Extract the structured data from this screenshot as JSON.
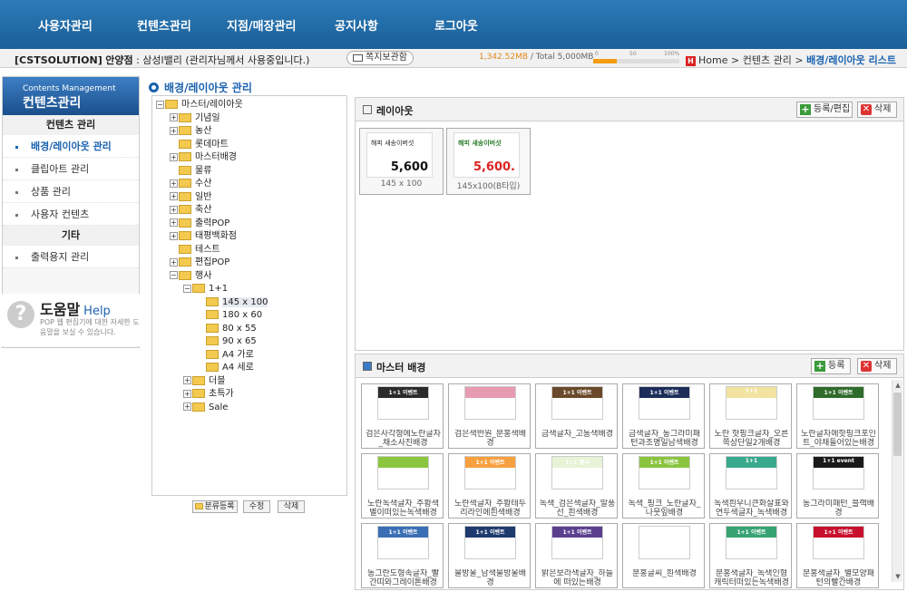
{
  "topnav": [
    "사용자관리",
    "컨텐츠관리",
    "지점/매장관리",
    "공지사항",
    "로그아웃"
  ],
  "status": {
    "company": "[CSTSOLUTION]",
    "branch": "안양점",
    "rest": ": 삼성l밸리 (관리자님께서 사용중입니다.)",
    "msg_button": "쪽지보관함",
    "used": "1,342.52MB",
    "total": "/ Total 5,000MB",
    "gauge_ticks": [
      "0",
      "50",
      "100%"
    ],
    "usage_percent": 27
  },
  "breadcrumb": {
    "home": "Home",
    "sep1": ">",
    "mid": "컨텐츠 관리",
    "sep2": ">",
    "current": "배경/레이아웃 리스트"
  },
  "sidebar": {
    "head_en": "Contents Management",
    "head_ko": "컨텐츠관리",
    "section1": "컨텐츠 관리",
    "items1": [
      "배경/레이아웃 관리",
      "클립아트 관리",
      "상품 관리",
      "사용자 컨텐츠"
    ],
    "section2": "기타",
    "items2": [
      "출력용지 관리"
    ],
    "help_title": "도움말",
    "help_en": "Help",
    "help_desc": "POP 웹 편집기에 대한 자세한 도움말을 보실 수 있습니다."
  },
  "page_title": "배경/레이아웃 관리",
  "tree": [
    {
      "label": "마스터/레이아웃",
      "level": 0,
      "exp": "−"
    },
    {
      "label": "기념일",
      "level": 1,
      "exp": "+"
    },
    {
      "label": "농산",
      "level": 1,
      "exp": "+"
    },
    {
      "label": "롯데마트",
      "level": 1,
      "exp": ""
    },
    {
      "label": "마스터배경",
      "level": 1,
      "exp": "+"
    },
    {
      "label": "물류",
      "level": 1,
      "exp": ""
    },
    {
      "label": "수산",
      "level": 1,
      "exp": "+"
    },
    {
      "label": "일반",
      "level": 1,
      "exp": "+"
    },
    {
      "label": "축산",
      "level": 1,
      "exp": "+"
    },
    {
      "label": "출력POP",
      "level": 1,
      "exp": "+"
    },
    {
      "label": "태평백화점",
      "level": 1,
      "exp": "+"
    },
    {
      "label": "테스트",
      "level": 1,
      "exp": ""
    },
    {
      "label": "편집POP",
      "level": 1,
      "exp": "+"
    },
    {
      "label": "행사",
      "level": 1,
      "exp": "−"
    },
    {
      "label": "1+1",
      "level": 2,
      "exp": "−"
    },
    {
      "label": "145 x 100",
      "level": 3,
      "exp": "",
      "selected": true
    },
    {
      "label": "180 x 60",
      "level": 3,
      "exp": ""
    },
    {
      "label": "80 x 55",
      "level": 3,
      "exp": ""
    },
    {
      "label": "90 x 65",
      "level": 3,
      "exp": ""
    },
    {
      "label": "A4 가로",
      "level": 3,
      "exp": ""
    },
    {
      "label": "A4 세로",
      "level": 3,
      "exp": ""
    },
    {
      "label": "더블",
      "level": 2,
      "exp": "+"
    },
    {
      "label": "초특가",
      "level": 2,
      "exp": "+"
    },
    {
      "label": "Sale",
      "level": 2,
      "exp": "+"
    }
  ],
  "tree_buttons": [
    "분류등록",
    "수정",
    "삭제"
  ],
  "layout_panel": {
    "title": "레이아웃",
    "btn_edit": "등록/편집",
    "btn_delete": "삭제",
    "thumbs": [
      {
        "caption": "145 x 100",
        "t1": "해피 새송이버섯",
        "t2": "5,600",
        "t2color": "#111"
      },
      {
        "caption": "145x100(B타입)",
        "t1": "해피 새송이버섯",
        "t2": "5,600.",
        "t2color": "#d22"
      }
    ]
  },
  "master_panel": {
    "title": "마스터 배경",
    "btn_add": "등록",
    "btn_delete": "삭제",
    "cards": [
      {
        "caption": "검은사각형에노란글자_채소사진배경",
        "color": "#2b2b2b",
        "band": "1+1 이벤트"
      },
      {
        "caption": "검은색반원_분홍색배경",
        "color": "#e79bb0",
        "band": ""
      },
      {
        "caption": "금색글자_고동색배경",
        "color": "#6a4a2a",
        "band": "1+1 이벤트"
      },
      {
        "caption": "금색글자_동그라미패턴과조명일남색배경",
        "color": "#1d2d5a",
        "band": "1+1 이벤트"
      },
      {
        "caption": "노란 핫핑크글자_오른쪽상단일2개배경",
        "color": "#f2e3a0",
        "band": "1+1"
      },
      {
        "caption": "노란글자에핫핑크포인트_야채들어있는배경",
        "color": "#2f6b2a",
        "band": "1+1 이벤트"
      },
      {
        "caption": "노란녹색글자_주황색별이떠있는녹색배경",
        "color": "#8cc63f",
        "band": ""
      },
      {
        "caption": "노란색글자_주황테두리라인에흰색배경",
        "color": "#f7a040",
        "band": "1+1 이벤트"
      },
      {
        "caption": "녹색_검은색글자_말풍선_흰색배경",
        "color": "#e7f3d6",
        "band": "1+1 행사"
      },
      {
        "caption": "녹색_핑크_노란글자_나뭇잎배경",
        "color": "#8ac43f",
        "band": "1+1 이벤트"
      },
      {
        "caption": "녹색흰우니큰화살표와연두색글자_녹색배경",
        "color": "#3aa88c",
        "band": "1+1"
      },
      {
        "caption": "동그라미패턴_블랙배경",
        "color": "#1a1a1a",
        "band": "1+1 event"
      },
      {
        "caption": "동그란도형속글자_빨간띠와그레이톤배경",
        "color": "#3a6fb5",
        "band": "1+1 이벤트"
      },
      {
        "caption": "물방울_남색물방울배경",
        "color": "#1f3a6e",
        "band": "1+1 이벤트"
      },
      {
        "caption": "밝은보라색글자_하늘에 떠있는배경",
        "color": "#5b3f8f",
        "band": "1+1 이벤트"
      },
      {
        "caption": "분홍글씨_흰색배경",
        "color": "#ffffff",
        "band": "1+1 이벤트"
      },
      {
        "caption": "분홍색글자_녹색인형 캐릭터떠있는녹색배경",
        "color": "#37a373",
        "band": "1+1 이벤트"
      },
      {
        "caption": "분홍색글자_별모양패턴의빨간배경",
        "color": "#c8102e",
        "band": "1+1 이벤트"
      }
    ]
  }
}
